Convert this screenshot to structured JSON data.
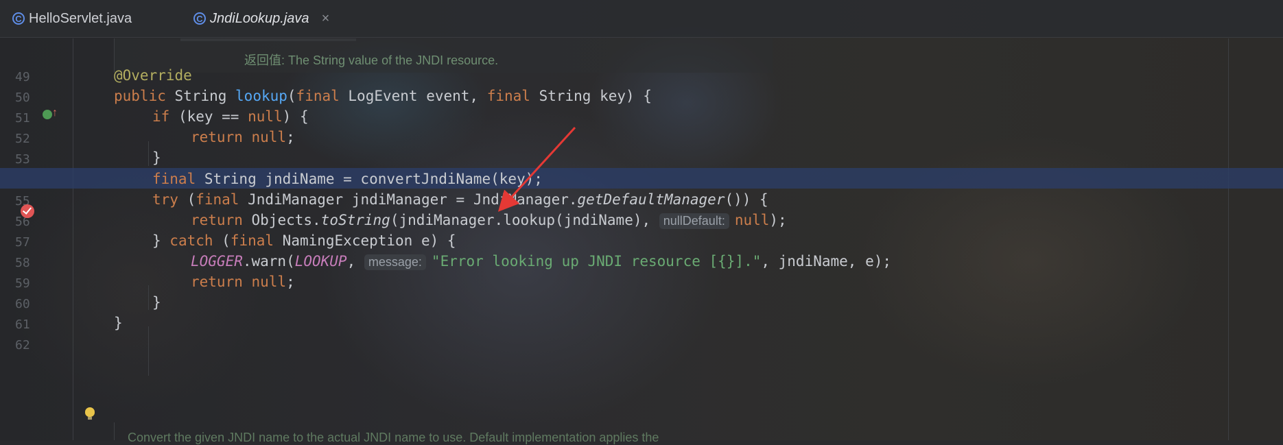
{
  "tabs": [
    {
      "icon": "java-class-icon",
      "label": "HelloServlet.java",
      "active": false
    },
    {
      "icon": "java-class-icon",
      "label": "JndiLookup.java",
      "active": true,
      "close": "×"
    }
  ],
  "docs": {
    "top": "返回值: The String value of the JNDI resource.",
    "bottom": "Convert the given JNDI name to the actual JNDI name to use. Default implementation applies the"
  },
  "lines": [
    {
      "num": "49",
      "indent": 0,
      "tokens": [
        {
          "t": "@Override",
          "c": "ann"
        }
      ]
    },
    {
      "num": "50",
      "indent": 0,
      "tokens": [
        {
          "t": "public ",
          "c": "kw"
        },
        {
          "t": "String "
        },
        {
          "t": "lookup",
          "c": "fn"
        },
        {
          "t": "("
        },
        {
          "t": "final ",
          "c": "kw"
        },
        {
          "t": "LogEvent event, "
        },
        {
          "t": "final ",
          "c": "kw"
        },
        {
          "t": "String key) {"
        }
      ]
    },
    {
      "num": "51",
      "indent": 1,
      "tokens": [
        {
          "t": "if ",
          "c": "kw"
        },
        {
          "t": "(key == "
        },
        {
          "t": "null",
          "c": "kw"
        },
        {
          "t": ") {"
        }
      ]
    },
    {
      "num": "52",
      "indent": 2,
      "tokens": [
        {
          "t": "return ",
          "c": "kw"
        },
        {
          "t": "null",
          "c": "kw"
        },
        {
          "t": ";"
        }
      ]
    },
    {
      "num": "53",
      "indent": 1,
      "tokens": [
        {
          "t": "}"
        }
      ]
    },
    {
      "num": "",
      "indent": 1,
      "highlight": true,
      "tokens": [
        {
          "t": "final ",
          "c": "kw"
        },
        {
          "t": "String jndiName = convertJndiName(key);"
        }
      ]
    },
    {
      "num": "55",
      "indent": 1,
      "tokens": [
        {
          "t": "try ",
          "c": "kw"
        },
        {
          "t": "("
        },
        {
          "t": "final ",
          "c": "kw"
        },
        {
          "t": "JndiManager jndiManager = JndiManager."
        },
        {
          "t": "getDefaultManager",
          "c": "it"
        },
        {
          "t": "()) {"
        }
      ]
    },
    {
      "num": "56",
      "indent": 2,
      "tokens": [
        {
          "t": "return ",
          "c": "kw"
        },
        {
          "t": "Objects."
        },
        {
          "t": "toString",
          "c": "it"
        },
        {
          "t": "(jndiManager.lookup(jndiName), "
        },
        {
          "t": "nullDefault:",
          "c": "hint"
        },
        {
          "t": "null",
          "c": "kw"
        },
        {
          "t": ");"
        }
      ]
    },
    {
      "num": "57",
      "indent": 1,
      "tokens": [
        {
          "t": "} "
        },
        {
          "t": "catch ",
          "c": "kw"
        },
        {
          "t": "("
        },
        {
          "t": "final ",
          "c": "kw"
        },
        {
          "t": "NamingException e) {"
        }
      ]
    },
    {
      "num": "58",
      "indent": 2,
      "tokens": [
        {
          "t": "LOGGER",
          "c": "const"
        },
        {
          "t": ".warn("
        },
        {
          "t": "LOOKUP",
          "c": "const"
        },
        {
          "t": ", "
        },
        {
          "t": "message:",
          "c": "hint"
        },
        {
          "t": "\"Error looking up JNDI resource [{}].\"",
          "c": "str"
        },
        {
          "t": ", jndiName, e);"
        }
      ]
    },
    {
      "num": "59",
      "indent": 2,
      "tokens": [
        {
          "t": "return ",
          "c": "kw"
        },
        {
          "t": "null",
          "c": "kw"
        },
        {
          "t": ";"
        }
      ]
    },
    {
      "num": "60",
      "indent": 1,
      "tokens": [
        {
          "t": "}"
        }
      ]
    },
    {
      "num": "61",
      "indent": 0,
      "tokens": [
        {
          "t": "}"
        }
      ]
    },
    {
      "num": "62",
      "indent": 0,
      "tokens": []
    }
  ],
  "gutter": {
    "implements_icon": "implements-icon",
    "breakpoint_icon": "breakpoint-icon",
    "bulb_icon": "intention-bulb-icon"
  },
  "colors": {
    "keyword": "#cc7e4c",
    "annotation": "#b3ae60",
    "method": "#56a8f5",
    "string": "#6aab73",
    "constant": "#c77dba",
    "highlight": "#2c3e68",
    "annotation_arrow": "#e53935"
  }
}
